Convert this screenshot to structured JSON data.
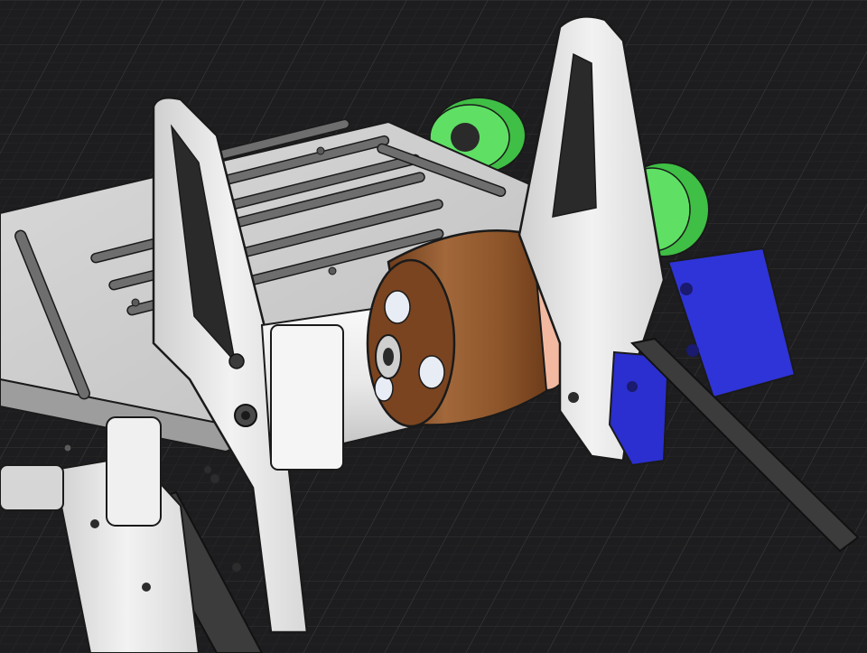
{
  "viewport": {
    "background": "#1d1d1f",
    "grid_color": "#3a3a3c",
    "grid_minor_color": "#2a2a2c"
  },
  "model": {
    "parts": [
      {
        "name": "chassis-plate",
        "color": "#e6e6e6"
      },
      {
        "name": "front-bracket",
        "color": "#ededed"
      },
      {
        "name": "rear-bracket",
        "color": "#ededed"
      },
      {
        "name": "motor-bell",
        "color": "#a86a3c"
      },
      {
        "name": "motor-ring",
        "color": "#f2b9a0"
      },
      {
        "name": "drive-shaft",
        "color": "#f4f4f4"
      },
      {
        "name": "wheel-left",
        "color": "#59d95b"
      },
      {
        "name": "wheel-right",
        "color": "#59d95b"
      },
      {
        "name": "mount-block",
        "color": "#2f32d6"
      },
      {
        "name": "support-arm",
        "color": "#3b3b3b"
      }
    ]
  }
}
